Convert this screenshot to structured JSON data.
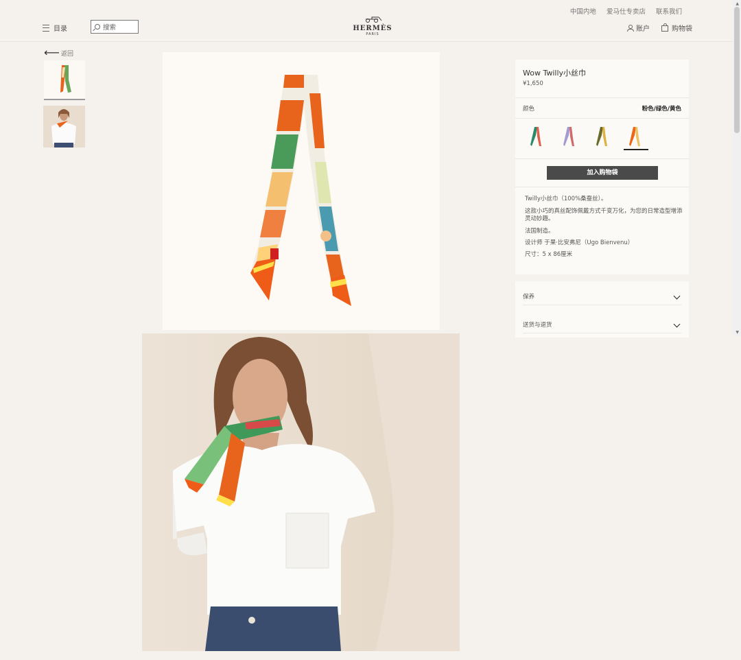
{
  "header": {
    "top_links": [
      "中国内地",
      "爱马仕专卖店",
      "联系我们"
    ],
    "menu_label": "目录",
    "search_placeholder": "搜索",
    "logo": {
      "brand": "HERMÈS",
      "city": "PARIS"
    },
    "account_label": "账户",
    "bag_label": "购物袋"
  },
  "gallery": {
    "back_label": "返回",
    "thumbnails": [
      "scarf-product-icon",
      "model-photo-icon"
    ]
  },
  "product": {
    "title": "Wow Twilly小丝巾",
    "price": "¥1,650",
    "color_label": "颜色",
    "color_value": "粉色/绿色/黄色",
    "swatches": [
      {
        "name": "green-variant",
        "colors": [
          "#2a8a6a",
          "#e0604a"
        ]
      },
      {
        "name": "lilac-variant",
        "colors": [
          "#a59ad0",
          "#d06a6a"
        ]
      },
      {
        "name": "olive-variant",
        "colors": [
          "#6a6a2a",
          "#e0b040"
        ]
      },
      {
        "name": "orange-variant",
        "colors": [
          "#e86a1a",
          "#f0c060"
        ],
        "selected": true
      }
    ],
    "add_to_bag": "加入购物袋",
    "description": {
      "line1": "Twilly小丝巾（100%桑蚕丝）。",
      "line2": "这款小巧的真丝配饰佩戴方式千变万化，为您的日常造型增添灵动妙趣。",
      "made_in": "法国制造。",
      "designer": "设计师 于果·比安弗尼（Ugo Bienvenu）",
      "size": "尺寸：5 x 86厘米"
    }
  },
  "accordion": [
    {
      "label": "保养"
    },
    {
      "label": "送货与退货"
    }
  ],
  "colors": {
    "background": "#f5f1ec",
    "card": "#fcfaf6",
    "button": "#4a4a4a",
    "scarf_orange": "#e8631c"
  }
}
